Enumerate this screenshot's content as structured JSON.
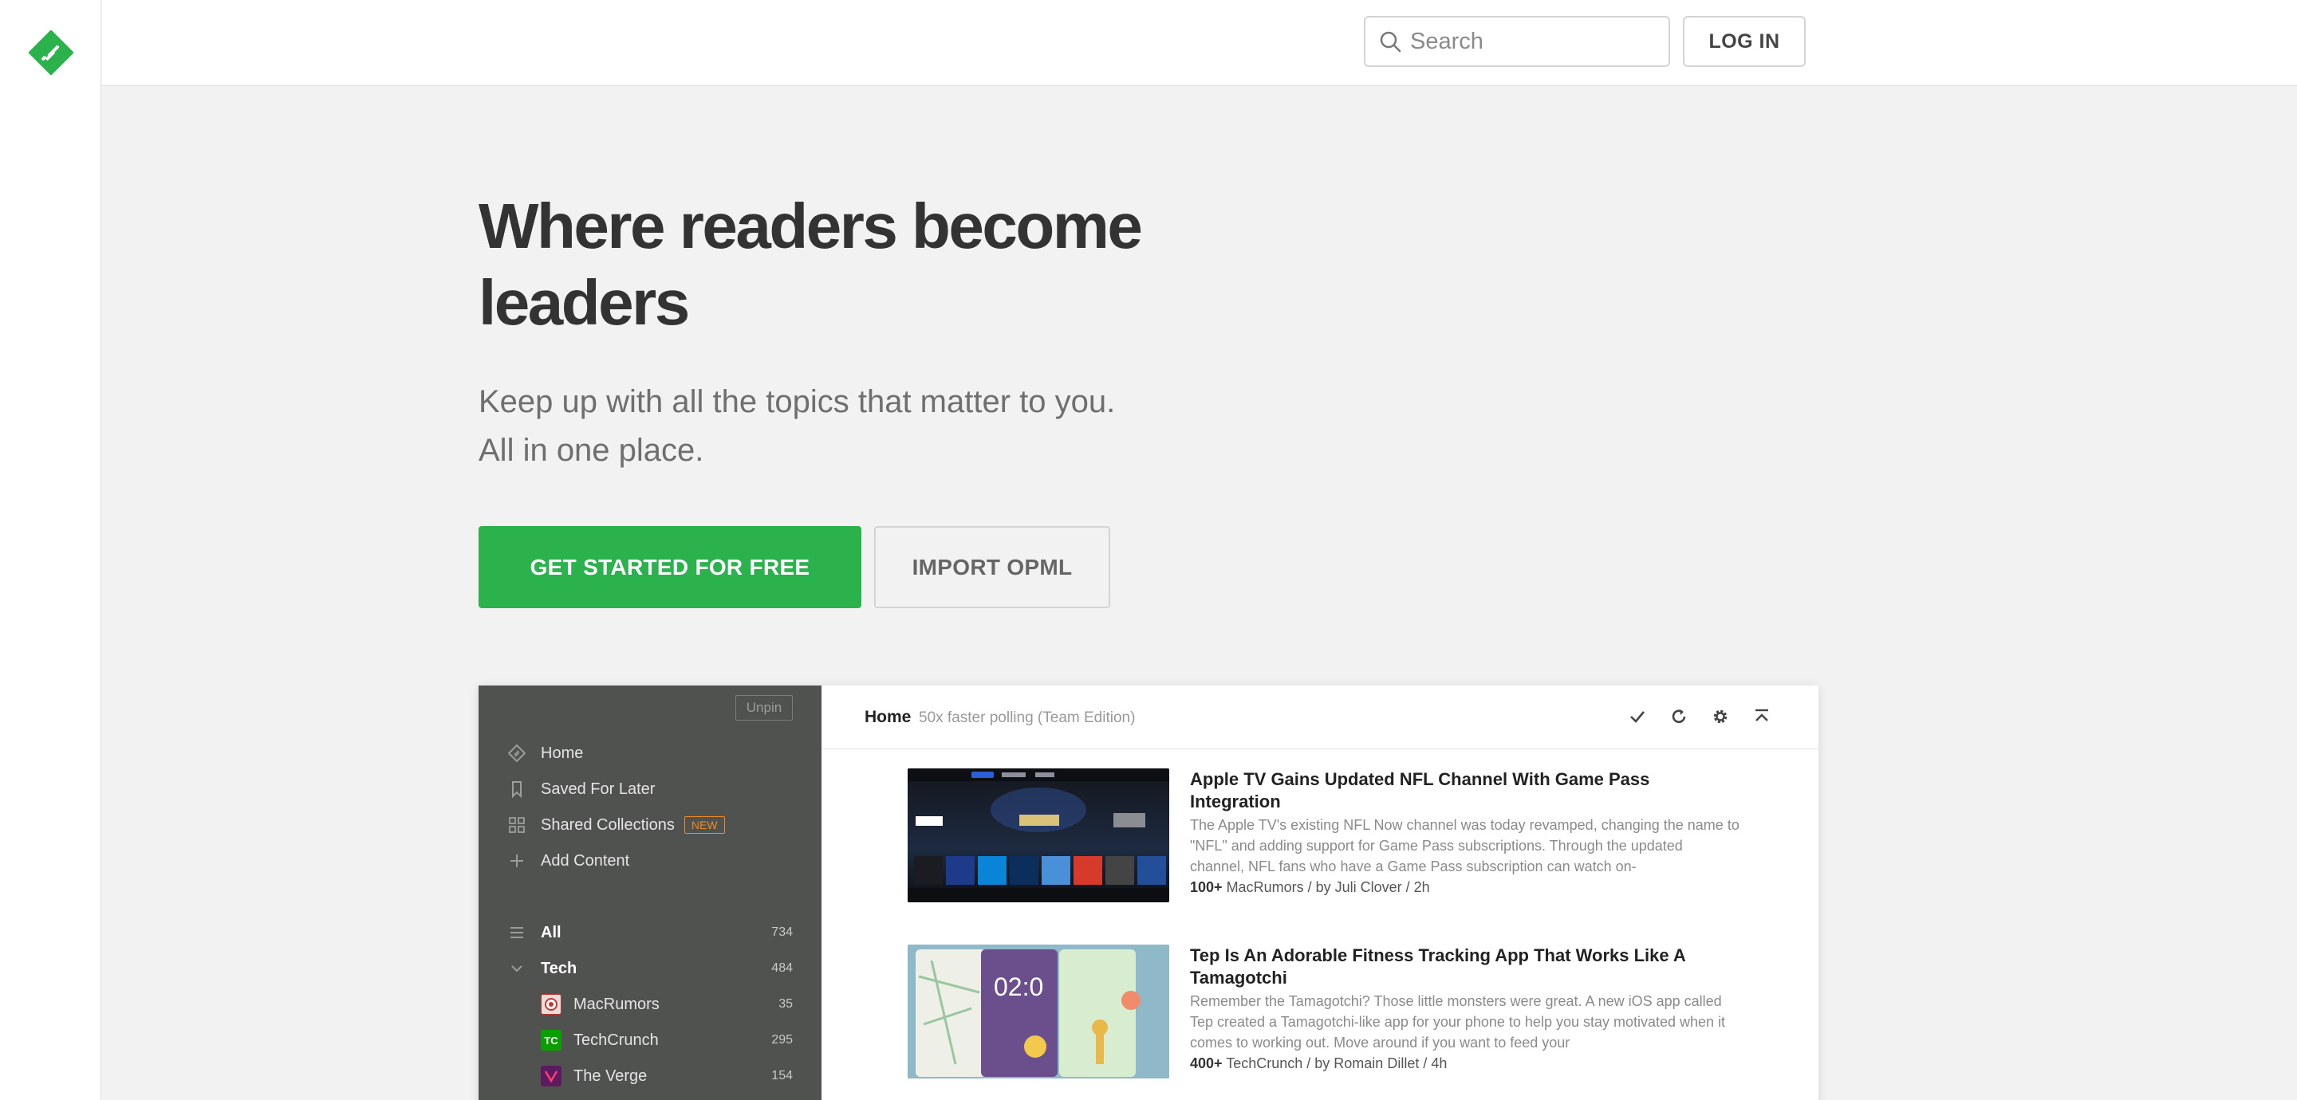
{
  "header": {
    "search_placeholder": "Search",
    "login_label": "LOG IN"
  },
  "hero": {
    "title_line1": "Where readers become",
    "title_line2": "leaders",
    "subtitle_line1": "Keep up with all the topics that matter to you.",
    "subtitle_line2": "All in one place.",
    "cta_label": "GET STARTED FOR FREE",
    "import_label": "IMPORT OPML"
  },
  "colors": {
    "brand_green": "#2bb24c",
    "sidebar_bg": "#505250",
    "new_badge": "#f08a24"
  },
  "app_preview": {
    "sidebar": {
      "unpin_label": "Unpin",
      "nav": [
        {
          "label": "Home",
          "icon": "home-icon"
        },
        {
          "label": "Saved For Later",
          "icon": "bookmark-icon"
        },
        {
          "label": "Shared Collections",
          "icon": "collections-icon",
          "badge": "NEW"
        },
        {
          "label": "Add Content",
          "icon": "plus-icon"
        }
      ],
      "all": {
        "label": "All",
        "count": "734"
      },
      "tech": {
        "label": "Tech",
        "count": "484"
      },
      "feeds": [
        {
          "label": "MacRumors",
          "count": "35"
        },
        {
          "label": "TechCrunch",
          "count": "295"
        },
        {
          "label": "The Verge",
          "count": "154"
        }
      ]
    },
    "main": {
      "title": "Home",
      "subtitle": "50x faster polling (Team Edition)",
      "articles": [
        {
          "title": "Apple TV Gains Updated NFL Channel With Game Pass Integration",
          "summary": "The Apple TV's existing NFL Now channel was today revamped, changing the name to \"NFL\" and adding support for Game Pass subscriptions. Through the updated channel, NFL fans who have a Game Pass subscription can watch on-",
          "count": "100+",
          "meta": "MacRumors / by Juli Clover / 2h"
        },
        {
          "title": "Tep Is An Adorable Fitness Tracking App That Works Like A Tamagotchi",
          "summary": "Remember the Tamagotchi? Those little monsters were great. A new iOS app called Tep created a Tamagotchi-like app for your phone to help you stay motivated when it comes to working out. Move around if you want to feed your",
          "count": "400+",
          "meta": "TechCrunch / by Romain Dillet / 4h"
        }
      ]
    }
  }
}
